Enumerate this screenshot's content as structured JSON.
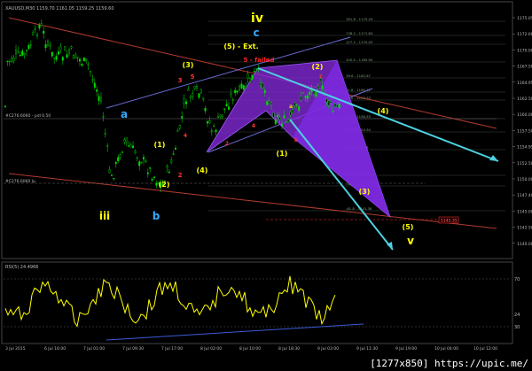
{
  "window": {
    "symbol_header": "XAUUSD,M30  1159.70 1161.05 1159.25 1159.60"
  },
  "price_scale": [
    "1175.05",
    "1172.60",
    "1170.00",
    "1167.50",
    "1164.95",
    "1162.50",
    "1160.00",
    "1157.50",
    "1154.95",
    "1152.50",
    "1150.00",
    "1147.40",
    "1145.00",
    "1142.50",
    "1140.00"
  ],
  "time_scale": [
    "3 Jul 2015",
    "6 Jul 16:00",
    "7 Jul 01:00",
    "7 Jul 09:30",
    "7 Jul 17:00",
    "8 Jul 02:00",
    "8 Jul 10:00",
    "8 Jul 18:30",
    "9 Jul 03:00",
    "9 Jul 11:30",
    "9 Jul 19:00",
    "10 Jul 04:00",
    "10 Jul 12:00"
  ],
  "rsi": {
    "header": "RSI(5) 24.4966",
    "levels": [
      "70",
      "30"
    ],
    "current_value": "24"
  },
  "line_labels": {
    "upper_left": "#C276.6060 - pdl 0.50",
    "lower_left": "#C276.6060 lp",
    "red_level": "1145.35"
  },
  "fib_labels": [
    "161.8 - 1175.29",
    "138.2 - 1171.84",
    "127.2 - 1170.03",
    "100.0 - 1165.90",
    "78.6 - 1162.67",
    "61.8 - 1160.11",
    "50.0 - 1158.33",
    "38.2 - 1156.55",
    "23.6 - 1154.34",
    "0.0 - 1150.75",
    "-23.6 - 1147.17",
    "-38.2 - 1144.95",
    "-61.8 - 1141.38"
  ],
  "wave_labels": [
    {
      "id": "iv",
      "text": "iv",
      "color": "#ffff00"
    },
    {
      "id": "c_blue",
      "text": "c",
      "color": "#33aaff"
    },
    {
      "id": "ext5",
      "text": "(5) - Ext.",
      "color": "#ffff00"
    },
    {
      "id": "failed5",
      "text": "5 - failed",
      "color": "#ff2222"
    },
    {
      "id": "p3",
      "text": "(3)",
      "color": "#ffff00"
    },
    {
      "id": "r3",
      "text": "3",
      "color": "#ff3333"
    },
    {
      "id": "r5",
      "text": "5",
      "color": "#ff3333"
    },
    {
      "id": "a_blue",
      "text": "a",
      "color": "#33aaff"
    },
    {
      "id": "r4",
      "text": "4",
      "color": "#ff3333"
    },
    {
      "id": "p1",
      "text": "(1)",
      "color": "#ffff00"
    },
    {
      "id": "r2",
      "text": "2",
      "color": "#ff3333"
    },
    {
      "id": "p4",
      "text": "(4)",
      "color": "#ffff00"
    },
    {
      "id": "iii",
      "text": "iii",
      "color": "#ffff00"
    },
    {
      "id": "b_blue",
      "text": "b",
      "color": "#33aaff"
    },
    {
      "id": "p2",
      "text": "(2)",
      "color": "#ffff00"
    },
    {
      "id": "p2b",
      "text": "(2)",
      "color": "#ffff00"
    },
    {
      "id": "p4b",
      "text": "(4)",
      "color": "#ffff00"
    },
    {
      "id": "p1b",
      "text": "(1)",
      "color": "#ffff00"
    },
    {
      "id": "p3b",
      "text": "(3)",
      "color": "#ffff00"
    },
    {
      "id": "p5",
      "text": "(5)",
      "color": "#ffff00"
    },
    {
      "id": "v",
      "text": "v",
      "color": "#ffff00"
    },
    {
      "id": "ro2",
      "text": "2",
      "color": "#ff3333"
    },
    {
      "id": "ro4",
      "text": "4",
      "color": "#ff3333"
    },
    {
      "id": "rb",
      "text": "b",
      "color": "#ff3333"
    },
    {
      "id": "rc",
      "text": "c",
      "color": "#ff3333"
    },
    {
      "id": "wa",
      "text": "a",
      "color": "#ffcc00"
    }
  ],
  "footer": "[1277x850] https://upic.me/",
  "colors": {
    "background": "#000000",
    "candle": "#00dd00",
    "rsi": "#ffff00",
    "pattern_fill": "#8a2be2",
    "projection": "#4dd0e1",
    "channel_red": "#c0392b"
  }
}
